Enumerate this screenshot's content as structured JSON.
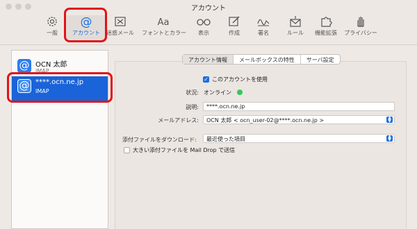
{
  "window": {
    "title": "アカウント"
  },
  "toolbar": {
    "items": [
      {
        "label": "一般",
        "icon": "gear-icon"
      },
      {
        "label": "アカウント",
        "icon": "at-icon"
      },
      {
        "label": "迷惑メール",
        "icon": "junk-mail-icon"
      },
      {
        "label": "フォントとカラー",
        "icon": "font-icon",
        "glyph": "Aa"
      },
      {
        "label": "表示",
        "icon": "glasses-icon"
      },
      {
        "label": "作成",
        "icon": "compose-icon"
      },
      {
        "label": "署名",
        "icon": "signature-icon"
      },
      {
        "label": "ルール",
        "icon": "rules-icon"
      },
      {
        "label": "機能拡張",
        "icon": "puzzle-icon"
      },
      {
        "label": "プライバシー",
        "icon": "hand-icon"
      }
    ],
    "active_index": 1,
    "accent": "#1a6fe0",
    "highlight": "#e0141a"
  },
  "sidebar": {
    "accounts": [
      {
        "name": "OCN 太郎",
        "type": "IMAP",
        "icon_glyph": "@"
      },
      {
        "name": "****.ocn.ne.jp",
        "type": "IMAP",
        "icon_glyph": "@"
      }
    ],
    "selected_index": 1
  },
  "tabs": [
    "アカウント情報",
    "メールボックスの特性",
    "サーバ設定"
  ],
  "active_tab": 0,
  "form": {
    "enable_label": "このアカウントを使用",
    "enable_checked": true,
    "status_label": "状況:",
    "status_value": "オンライン",
    "status_color": "#34c759",
    "description_label": "説明:",
    "description_value": "****.ocn.ne.jp",
    "email_label": "メールアドレス:",
    "email_value": "OCN 太郎 < ocn_user-02@****.ocn.ne.jp >",
    "download_label": "添付ファイルをダウンロード:",
    "download_value": "最近使った項目",
    "maildrop_label": "大きい添付ファイルを Mail Drop で送信",
    "maildrop_checked": false
  }
}
